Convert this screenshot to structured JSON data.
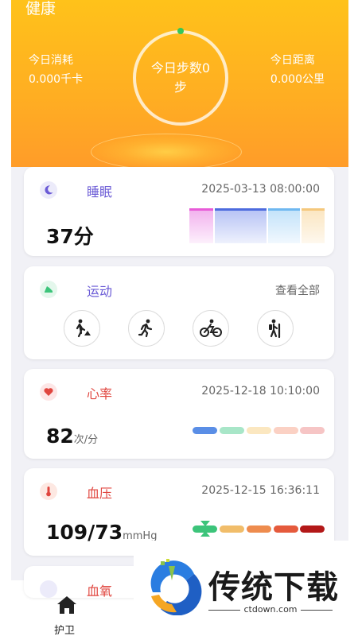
{
  "header": {
    "title": "健康",
    "calories": {
      "label": "今日消耗",
      "value": "0.000千卡"
    },
    "distance": {
      "label": "今日距离",
      "value": "0.000公里"
    },
    "steps": {
      "line1": "今日步数0",
      "line2": "步"
    }
  },
  "sleep": {
    "title": "睡眠",
    "timestamp": "2025-03-13 08:00:00",
    "value": "37分",
    "colors": {
      "title": "#6b5bd6",
      "bars": [
        "#e85bd8",
        "#4d6bde",
        "#6fb8f0",
        "#f5c87c"
      ]
    }
  },
  "sport": {
    "title": "运动",
    "view_all": "查看全部",
    "icons": [
      "walk-icon",
      "run-icon",
      "cycle-icon",
      "hike-icon"
    ],
    "colors": {
      "title": "#6b5bd6",
      "icon_bg": "#3cc47a"
    }
  },
  "heart": {
    "title": "心率",
    "timestamp": "2025-12-18 10:10:00",
    "value": "82",
    "unit": "次/分",
    "colors": {
      "title": "#e0463f",
      "pills": [
        "#5a8ee6",
        "#a8e6c8",
        "#fbe7c0",
        "#fbd1c4",
        "#f6c5c5"
      ]
    }
  },
  "blood_pressure": {
    "title": "血压",
    "timestamp": "2025-12-15 16:36:11",
    "value": "109/73",
    "unit": "mmHg",
    "colors": {
      "title": "#e0463f",
      "pills": [
        "#3cc47a",
        "#f1bd6a",
        "#ee8c4e",
        "#e55a3c",
        "#b31818"
      ]
    }
  },
  "blood_oxygen": {
    "title": "血氧"
  },
  "watermark": {
    "text": "传统下载",
    "url": "ctdown.com"
  },
  "nav": {
    "home_label": "护卫"
  }
}
